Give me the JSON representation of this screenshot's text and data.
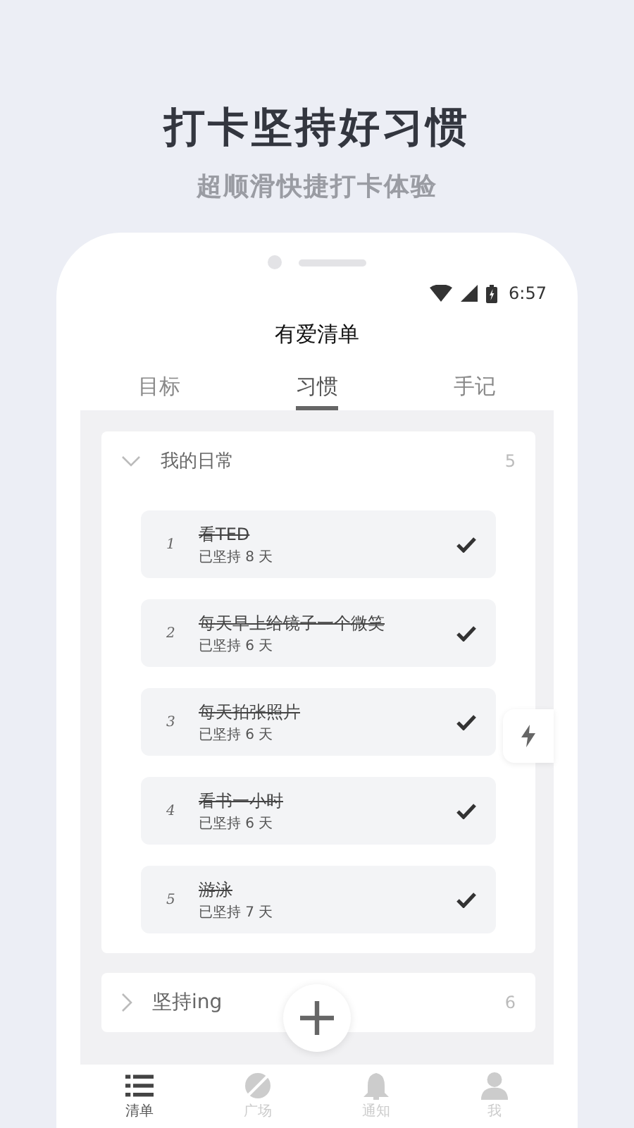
{
  "headline": "打卡坚持好习惯",
  "subtitle": "超顺滑快捷打卡体验",
  "status_bar": {
    "time": "6:57"
  },
  "app_title": "有爱清单",
  "tabs": [
    {
      "label": "目标",
      "selected": false
    },
    {
      "label": "习惯",
      "selected": true
    },
    {
      "label": "手记",
      "selected": false
    }
  ],
  "groups": [
    {
      "name": "我的日常",
      "count": "5",
      "expanded": true,
      "items": [
        {
          "index": "1",
          "title": "看TED",
          "streak": "已坚持 8 天",
          "done": true
        },
        {
          "index": "2",
          "title": "每天早上给镜子一个微笑",
          "streak": "已坚持 6 天",
          "done": true
        },
        {
          "index": "3",
          "title": "每天拍张照片",
          "streak": "已坚持 6 天",
          "done": true
        },
        {
          "index": "4",
          "title": "看书一小时",
          "streak": "已坚持 6 天",
          "done": true
        },
        {
          "index": "5",
          "title": "游泳",
          "streak": "已坚持 7 天",
          "done": true
        }
      ]
    },
    {
      "name": "坚持ing",
      "count": "6",
      "expanded": false
    }
  ],
  "bottom_nav": [
    {
      "kind": "list",
      "label": "清单",
      "selected": true
    },
    {
      "kind": "plaza",
      "label": "广场",
      "selected": false
    },
    {
      "kind": "bell",
      "label": "通知",
      "selected": false
    },
    {
      "kind": "person",
      "label": "我",
      "selected": false
    }
  ]
}
